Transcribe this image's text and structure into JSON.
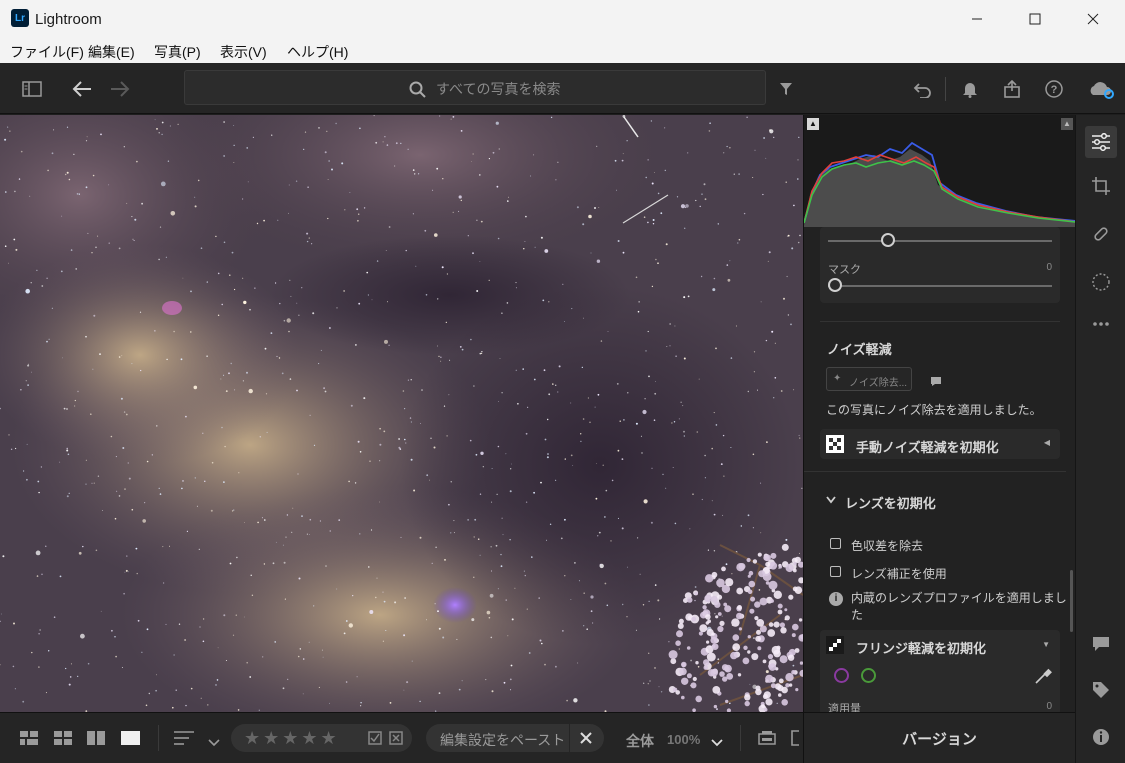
{
  "window": {
    "title": "Lightroom",
    "logo_text": "Lr"
  },
  "menu": [
    "ファイル(F)",
    "編集(E)",
    "写真(P)",
    "表示(V)",
    "ヘルプ(H)"
  ],
  "search": {
    "placeholder": "すべての写真を検索"
  },
  "panel": {
    "mask_label": "マスク",
    "mask_value": "0",
    "noise_header": "ノイズ軽減",
    "denoise_button": "ノイズ除去...",
    "denoise_applied": "この写真にノイズ除去を適用しました。",
    "manual_noise": "手動ノイズ軽減を初期化",
    "lens_header": "レンズを初期化",
    "remove_ca": "色収差を除去",
    "use_profile": "レンズ補正を使用",
    "builtin_profile": "内蔵のレンズプロファイルを適用しました",
    "fringe": "フリンジ軽減を初期化",
    "amount_label": "適用量",
    "amount_value": "0"
  },
  "filmstrip": {
    "paste_label": "編集設定をペースト",
    "fit_label": "全体",
    "zoom_label": "100%"
  },
  "version_label": "バージョン",
  "histogram": {
    "colors": {
      "red": "#e0403a",
      "green": "#3ec24a",
      "blue": "#3a5ce8"
    }
  }
}
